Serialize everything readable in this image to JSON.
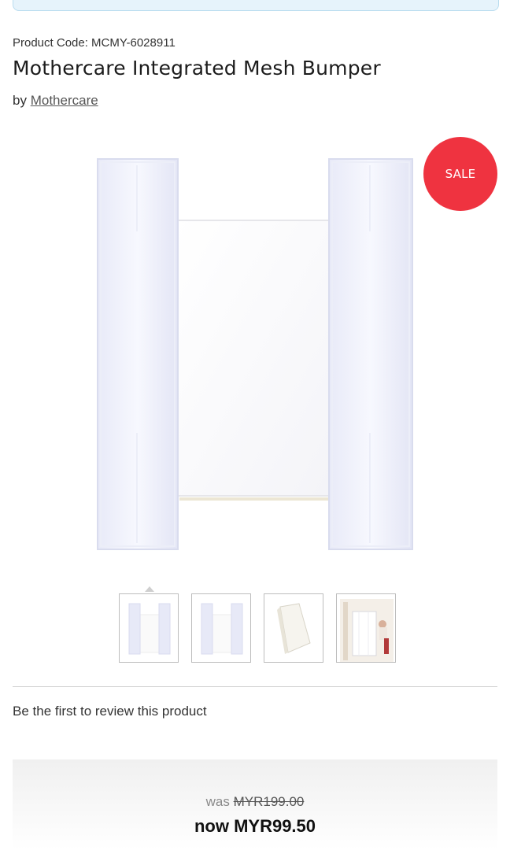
{
  "product": {
    "code_label": "Product Code: MCMY-6028911",
    "title": "Mothercare Integrated Mesh Bumper",
    "by_label": "by",
    "brand": "Mothercare"
  },
  "badge": {
    "sale_label": "SALE",
    "color": "#ef3340"
  },
  "gallery": {
    "main_image": "white mesh cot bumper",
    "thumbnails": [
      {
        "name": "bumper-front-view",
        "selected": true
      },
      {
        "name": "bumper-flat-view",
        "selected": false
      },
      {
        "name": "bumper-folded-view",
        "selected": false
      },
      {
        "name": "bumper-in-cot-view",
        "selected": false
      }
    ]
  },
  "reviews": {
    "prompt": "Be the first to review this product"
  },
  "price": {
    "was_label": "was",
    "was_value": "MYR199.00",
    "now_label": "now MYR99.50"
  }
}
